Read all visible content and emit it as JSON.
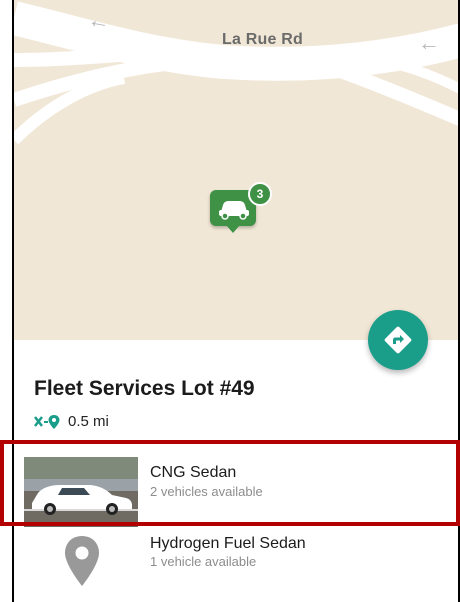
{
  "map": {
    "road_label": "La Rue Rd",
    "marker_count": "3",
    "marker_icon": "car-icon",
    "directions_icon": "directions-icon"
  },
  "location": {
    "title": "Fleet Services Lot #49",
    "distance": "0.5 mi",
    "distance_icon": "distance-icon"
  },
  "vehicles": [
    {
      "name": "CNG Sedan",
      "availability": "2 vehicles available",
      "image": "car-photo"
    },
    {
      "name": "Hydrogen Fuel Sedan",
      "availability": "1 vehicle available",
      "image": "place-icon"
    }
  ],
  "colors": {
    "accent_fab": "#1a9e8a",
    "marker_green": "#3f9146",
    "map_background": "#f1e7d6",
    "highlight": "#b30000"
  }
}
